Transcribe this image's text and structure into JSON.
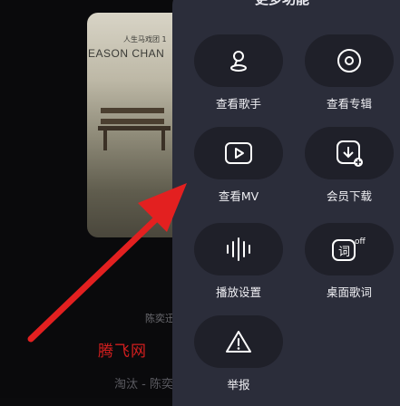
{
  "panel": {
    "title": "更多功能",
    "items": [
      {
        "label": "查看歌手",
        "icon": "singer-icon"
      },
      {
        "label": "查看专辑",
        "icon": "album-icon"
      },
      {
        "label": "查看MV",
        "icon": "play-icon"
      },
      {
        "label": "会员下载",
        "icon": "download-icon"
      },
      {
        "label": "播放设置",
        "icon": "sound-wave-icon"
      },
      {
        "label": "桌面歌词",
        "icon": "lyrics-icon"
      },
      {
        "label": "举报",
        "icon": "warning-icon"
      }
    ]
  },
  "background": {
    "album_artist": "EASON CHAN",
    "album_sub": "人生马戏团 1",
    "song_artist": "陈奕迅",
    "watermark": "腾飞网",
    "bottom_text": "淘汰 - 陈奕"
  },
  "colors": {
    "panel": "#2b2d3a",
    "pill": "#1f2029",
    "arrow": "#e32020",
    "watermark": "#d21e1e"
  }
}
